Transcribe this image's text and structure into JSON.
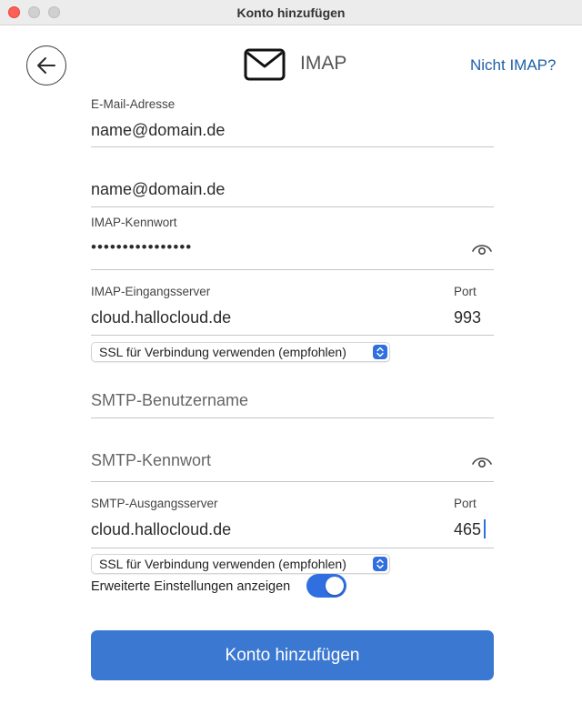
{
  "window": {
    "title": "Konto hinzufügen"
  },
  "header": {
    "title": "IMAP",
    "not_imap_link": "Nicht IMAP?",
    "icon": "mail-icon",
    "back_icon": "arrow-left-icon"
  },
  "form": {
    "email": {
      "label": "E-Mail-Adresse",
      "value": "name@domain.de"
    },
    "username": {
      "value": "name@domain.de"
    },
    "imap_password": {
      "label": "IMAP-Kennwort",
      "value": "••••••••••••••••"
    },
    "imap_server": {
      "label": "IMAP-Eingangsserver",
      "value": "cloud.hallocloud.de",
      "port_label": "Port",
      "port": "993"
    },
    "imap_ssl": {
      "selected": "SSL für Verbindung verwenden (empfohlen)"
    },
    "smtp_username": {
      "placeholder": "SMTP-Benutzername"
    },
    "smtp_password": {
      "placeholder": "SMTP-Kennwort"
    },
    "smtp_server": {
      "label": "SMTP-Ausgangsserver",
      "value": "cloud.hallocloud.de",
      "port_label": "Port",
      "port": "465"
    },
    "smtp_ssl": {
      "selected": "SSL für Verbindung verwenden (empfohlen)"
    },
    "advanced": {
      "label": "Erweiterte Einstellungen anzeigen",
      "enabled": true
    }
  },
  "submit": {
    "label": "Konto hinzufügen"
  },
  "colors": {
    "accent": "#3b78d2",
    "link": "#1f5fa8",
    "toggle_on": "#2f6fe0"
  }
}
